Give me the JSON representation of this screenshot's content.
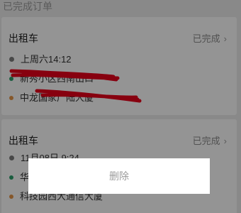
{
  "section": {
    "title": "已完成订单"
  },
  "orders": [
    {
      "title": "出租车",
      "status": "已完成",
      "time": "上周六14:12",
      "start": "新秀小区西南出口",
      "end": "中龙国家广陆大厦"
    },
    {
      "title": "出租车",
      "status": "已完成",
      "time": "11月08日 9:24",
      "start": "华",
      "end": "科技园西大通信大厦"
    }
  ],
  "dialog": {
    "delete_label": "删除"
  },
  "icons": {
    "chevron": "chevron-right-icon",
    "time": "clock-icon",
    "start": "green-dot-icon",
    "end": "orange-dot-icon"
  },
  "colors": {
    "redaction": "#e8001b",
    "start_dot": "#2ea06b",
    "end_dot": "#e69749"
  }
}
